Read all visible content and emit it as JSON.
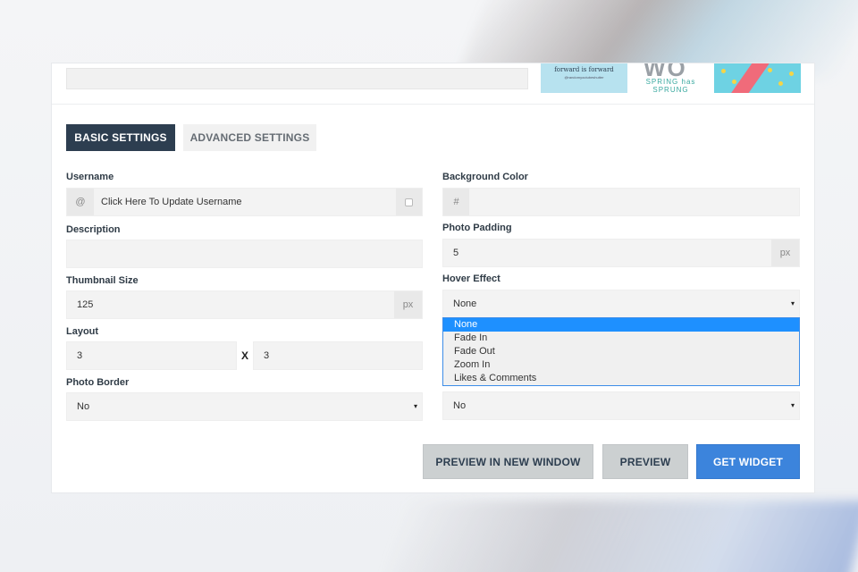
{
  "colors": {
    "accent": "#3c84dc",
    "tab_active": "#2d3e50",
    "dropdown_selected": "#1e90ff"
  },
  "thumbnails": [
    {
      "title": "forward is forward",
      "subtitle": "@randomyoutubeshutter"
    },
    {
      "big_text": "WO",
      "title": "SPRING has SPRUNG"
    },
    {
      "title": ""
    }
  ],
  "tabs": {
    "basic": "BASIC SETTINGS",
    "advanced": "ADVANCED SETTINGS"
  },
  "left": {
    "username": {
      "label": "Username",
      "prefix": "@",
      "placeholder": "Click Here To Update Username",
      "icon": "checkbox-icon"
    },
    "description": {
      "label": "Description",
      "value": ""
    },
    "thumbnail_size": {
      "label": "Thumbnail Size",
      "value": "125",
      "suffix": "px"
    },
    "layout": {
      "label": "Layout",
      "cols": "3",
      "separator": "X",
      "rows": "3"
    },
    "photo_border": {
      "label": "Photo Border",
      "value": "No",
      "caret": "▾"
    }
  },
  "right": {
    "background_color": {
      "label": "Background Color",
      "prefix": "#",
      "value": ""
    },
    "photo_padding": {
      "label": "Photo Padding",
      "value": "5",
      "suffix": "px"
    },
    "hover_effect": {
      "label": "Hover Effect",
      "value": "None",
      "caret": "▾",
      "options": [
        "None",
        "Fade In",
        "Fade Out",
        "Zoom In",
        "Likes & Comments"
      ],
      "selected_index": 0
    },
    "hidden_select": {
      "value": "No",
      "caret": "▾"
    }
  },
  "buttons": {
    "preview_new_window": "PREVIEW IN NEW WINDOW",
    "preview": "PREVIEW",
    "get_widget": "GET WIDGET"
  }
}
